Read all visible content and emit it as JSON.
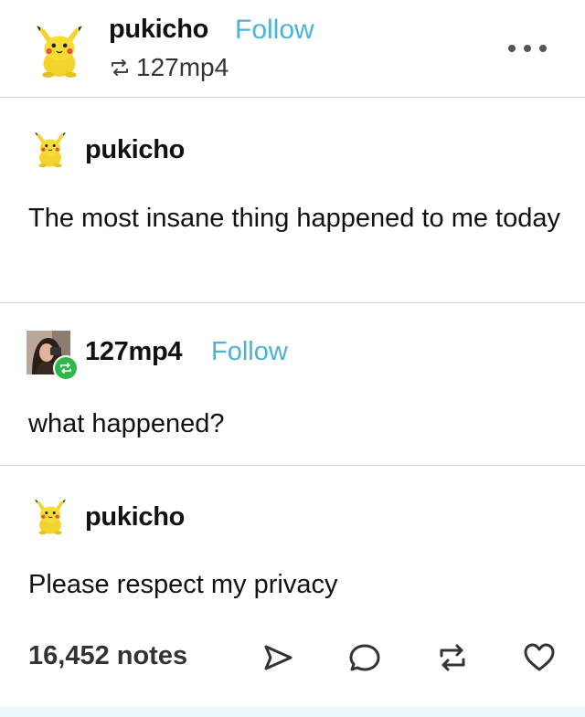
{
  "header": {
    "username": "pukicho",
    "follow_label": "Follow",
    "reblogged_from": "127mp4",
    "more_icon": "ellipsis-icon"
  },
  "thread": [
    {
      "username": "pukicho",
      "text": "The most insane thing happened to me today"
    },
    {
      "username": "127mp4",
      "follow_label": "Follow",
      "text": "what happened?"
    },
    {
      "username": "pukicho",
      "text": "Please respect my privacy"
    }
  ],
  "footer": {
    "notes": "16,452 notes",
    "actions": [
      "share-icon",
      "reply-icon",
      "reblog-icon",
      "like-icon"
    ]
  },
  "colors": {
    "follow": "#4ab3d6",
    "reblog_badge": "#2fb84a",
    "divider": "#d4d4d4"
  }
}
